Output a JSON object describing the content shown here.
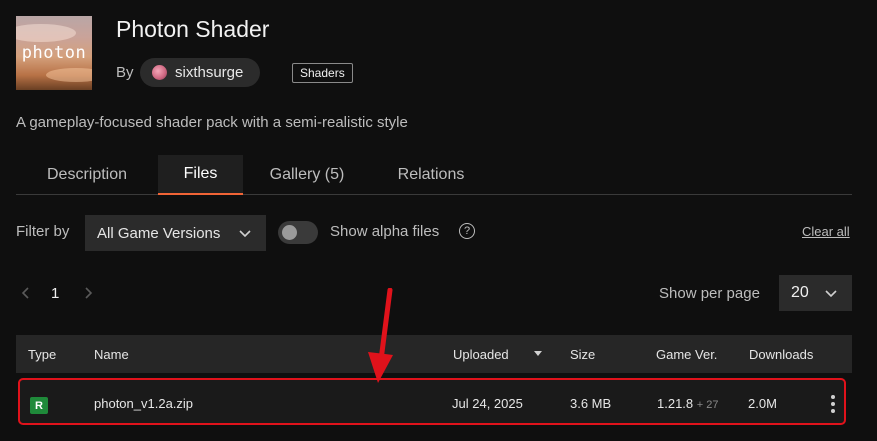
{
  "project": {
    "thumbnail_text": "photon",
    "title": "Photon Shader",
    "by_label": "By",
    "author": "sixthsurge",
    "category_tag": "Shaders",
    "summary": "A gameplay-focused shader pack with a semi-realistic style"
  },
  "tabs": [
    {
      "label": "Description",
      "active": false
    },
    {
      "label": "Files",
      "active": true
    },
    {
      "label": "Gallery (5)",
      "active": false
    },
    {
      "label": "Relations",
      "active": false
    }
  ],
  "filters": {
    "filter_by_label": "Filter by",
    "game_version_value": "All Game Versions",
    "show_alpha_label": "Show alpha files",
    "show_alpha_enabled": false,
    "help_icon": "question-circle-icon",
    "clear_all_label": "Clear all"
  },
  "pagination": {
    "current_page": "1",
    "show_per_page_label": "Show per page",
    "per_page_value": "20"
  },
  "table": {
    "columns": [
      "Type",
      "Name",
      "Uploaded",
      "Size",
      "Game Ver.",
      "Downloads"
    ],
    "rows": [
      {
        "type": "R",
        "name": "photon_v1.2a.zip",
        "uploaded": "Jul 24, 2025",
        "size": "3.6 MB",
        "game_ver": "1.21.8",
        "game_ver_extra": "+ 27",
        "downloads": "2.0M"
      }
    ]
  },
  "colors": {
    "accent": "#f16436",
    "release_badge": "#1f8a3a",
    "highlight": "#e0121b"
  }
}
